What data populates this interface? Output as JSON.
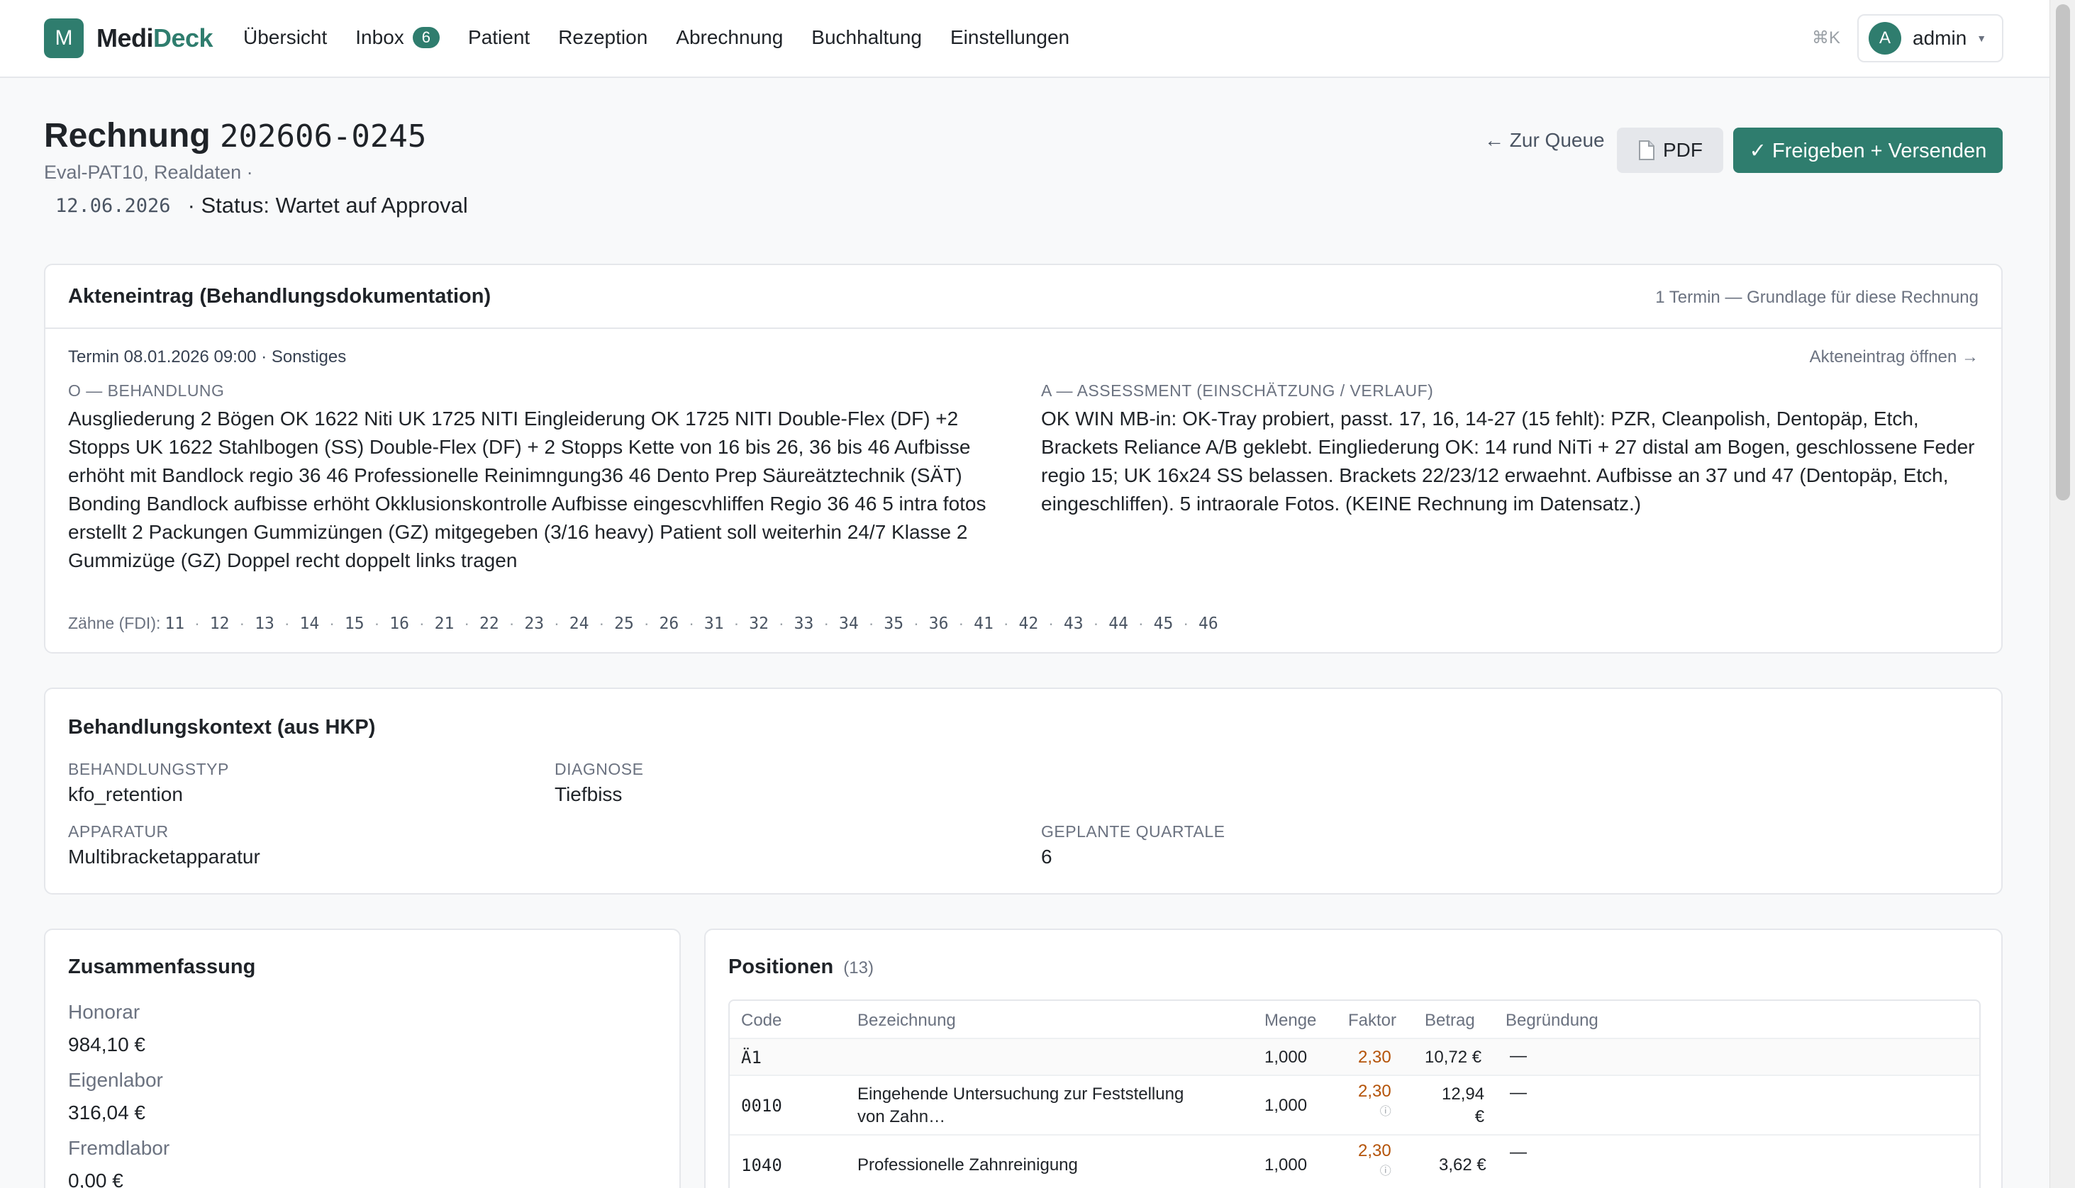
{
  "app": {
    "logo_letter": "M",
    "name_part1": "Medi",
    "name_part2": "Deck",
    "accent": "#2f7d6e"
  },
  "nav": {
    "items": [
      {
        "label": "Übersicht"
      },
      {
        "label": "Inbox",
        "badge": "6"
      },
      {
        "label": "Patient"
      },
      {
        "label": "Rezeption"
      },
      {
        "label": "Abrechnung"
      },
      {
        "label": "Buchhaltung"
      },
      {
        "label": "Einstellungen"
      }
    ],
    "shortcut": "⌘K",
    "user_initial": "A",
    "user_name": "admin"
  },
  "header": {
    "title_prefix": "Rechnung",
    "invoice_number": "202606-0245",
    "subline": "Eval-PAT10, Realdaten ·",
    "date": "12.06.2026",
    "status": "· Status: Wartet auf Approval",
    "back_label": "← Zur Queue",
    "pdf_label": "PDF",
    "approve_label": "✓ Freigeben + Versenden"
  },
  "akte": {
    "title": "Akteneintrag (Behandlungsdokumentation)",
    "right_note": "1 Termin — Grundlage für diese Rechnung",
    "termin": "Termin 08.01.2026 09:00 · Sonstiges",
    "open_link": "Akteneintrag öffnen →",
    "o_label": "O — BEHANDLUNG",
    "o_text": "Ausgliederung 2 Bögen OK 1622 Niti UK 1725 NITI Eingleiderung OK 1725 NITI Double-Flex (DF) +2 Stopps UK 1622 Stahlbogen (SS) Double-Flex (DF) + 2 Stopps Kette von 16 bis 26, 36 bis 46 Aufbisse erhöht mit Bandlock regio 36 46 Professionelle Reinimngung36 46 Dento Prep Säureätztechnik (SÄT) Bonding Bandlock aufbisse erhöht Okklusionskontrolle Aufbisse eingescvhliffen Regio 36 46 5 intra fotos erstellt 2 Packungen Gummizüngen (GZ) mitgegeben (3/16 heavy) Patient soll weiterhin 24/7 Klasse 2 Gummizüge (GZ) Doppel recht doppelt links tragen",
    "a_label": "A — ASSESSMENT (EINSCHÄTZUNG / VERLAUF)",
    "a_text": "OK WIN MB-in: OK-Tray probiert, passt. 17, 16, 14-27 (15 fehlt): PZR, Cleanpolish, Dentopäp, Etch, Brackets Reliance A/B geklebt. Eingliederung OK: 14 rund NiTi + 27 distal am Bogen, geschlossene Feder regio 15; UK 16x24 SS belassen. Brackets 22/23/12 erwaehnt. Aufbisse an 37 und 47 (Dentopäp, Etch, eingeschliffen). 5 intraorale Fotos. (KEINE Rechnung im Datensatz.)",
    "teeth_label": "Zähne (FDI):",
    "teeth": [
      "11",
      "12",
      "13",
      "14",
      "15",
      "16",
      "21",
      "22",
      "23",
      "24",
      "25",
      "26",
      "31",
      "32",
      "33",
      "34",
      "35",
      "36",
      "41",
      "42",
      "43",
      "44",
      "45",
      "46"
    ]
  },
  "context": {
    "title": "Behandlungskontext (aus HKP)",
    "behandlungstyp_label": "BEHANDLUNGSTYP",
    "behandlungstyp": "kfo_retention",
    "diagnose_label": "DIAGNOSE",
    "diagnose": "Tiefbiss",
    "apparatur_label": "APPARATUR",
    "apparatur": "Multibracketapparatur",
    "quartale_label": "GEPLANTE QUARTALE",
    "quartale": "6"
  },
  "summary": {
    "title": "Zusammenfassung",
    "honorar_label": "Honorar",
    "honorar": "984,10 €",
    "eigenlabor_label": "Eigenlabor",
    "eigenlabor": "316,04 €",
    "fremdlabor_label": "Fremdlabor",
    "fremdlabor": "0,00 €"
  },
  "positions": {
    "title": "Positionen",
    "count": "(13)",
    "columns": {
      "code": "Code",
      "bezeichnung": "Bezeichnung",
      "menge": "Menge",
      "faktor": "Faktor",
      "betrag": "Betrag",
      "begruendung": "Begründung"
    },
    "rows": [
      {
        "code": "Ä1",
        "bezeichnung": "",
        "menge": "1,000",
        "faktor": "2,30",
        "betrag": "10,72 €",
        "begruendung": "—"
      },
      {
        "code": "0010",
        "bezeichnung_1": "Eingehende Untersuchung zur Feststellung",
        "bezeichnung_2": "von Zahn…",
        "menge": "1,000",
        "faktor": "2,30",
        "betrag_1": "12,94",
        "betrag_2": "€",
        "begruendung": "—"
      },
      {
        "code": "1040",
        "bezeichnung": "Professionelle Zahnreinigung",
        "menge": "1,000",
        "faktor": "2,30",
        "betrag": "3,62 €",
        "begruendung": "—"
      }
    ],
    "info_glyph": "ⓘ"
  }
}
